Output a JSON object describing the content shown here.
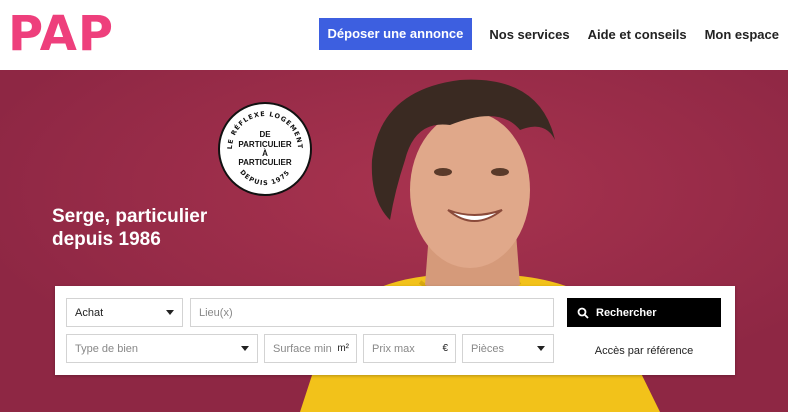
{
  "header": {
    "logo": "PAP",
    "cta_label": "Déposer une annonce",
    "nav": [
      "Nos services",
      "Aide et conseils",
      "Mon espace"
    ]
  },
  "stamp": {
    "ring_top": "LE RÉFLEXE LOGEMENT",
    "ring_bottom": "DEPUIS 1975",
    "center": [
      "DE",
      "PARTICULIER",
      "À",
      "PARTICULIER"
    ]
  },
  "hero": {
    "title_line1": "Serge, particulier",
    "title_line2": "depuis 1986"
  },
  "search": {
    "transaction_value": "Achat",
    "location_placeholder": "Lieu(x)",
    "property_type_placeholder": "Type de bien",
    "surface_placeholder": "Surface min",
    "surface_unit": "m²",
    "price_placeholder": "Prix max",
    "price_unit": "€",
    "rooms_placeholder": "Pièces",
    "submit_label": "Rechercher",
    "reference_link": "Accès par référence"
  },
  "colors": {
    "brand_pink": "#ee3f7c",
    "cta_blue": "#3d5fe0",
    "hero_bg": "#9a2c4a",
    "shirt_yellow": "#f2c21a"
  }
}
